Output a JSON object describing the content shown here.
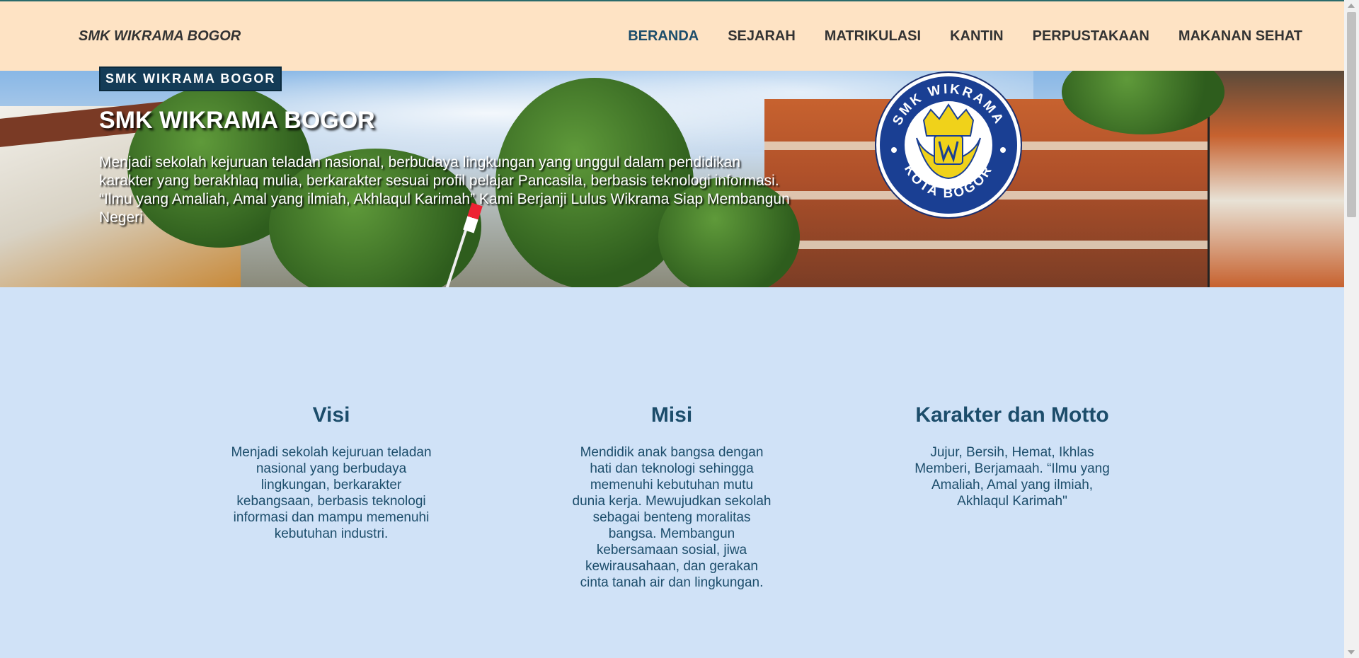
{
  "navbar": {
    "brand": "SMK WIKRAMA BOGOR",
    "links": [
      "BERANDA",
      "SEJARAH",
      "MATRIKULASI",
      "KANTIN",
      "PERPUSTAKAAN",
      "MAKANAN SEHAT"
    ],
    "active": "BERANDA"
  },
  "hero": {
    "badge": "SMK WIKRAMA BOGOR",
    "title": "SMK WIKRAMA BOGOR",
    "description": "Menjadi sekolah kejuruan teladan nasional, berbudaya lingkungan yang unggul dalam pendidikan karakter yang berakhlaq mulia, berkarakter sesuai profil pelajar Pancasila, berbasis teknologi informasi. “Ilmu yang Amaliah, Amal yang ilmiah, Akhlaqul Karimah” Kami Berjanji Lulus Wikrama Siap Membangun Negeri",
    "logo_top_text": "SMK WIKRAMA",
    "logo_bottom_text": "KOTA BOGOR"
  },
  "sections": [
    {
      "title": "Visi",
      "text": "Menjadi sekolah kejuruan teladan nasional yang berbudaya lingkungan, berkarakter kebangsaan, berbasis teknologi informasi dan mampu memenuhi kebutuhan industri."
    },
    {
      "title": "Misi",
      "text": "Mendidik anak bangsa dengan hati dan teknologi sehingga memenuhi kebutuhan mutu dunia kerja. Mewujudkan sekolah sebagai benteng moralitas bangsa. Membangun kebersamaan sosial, jiwa kewirausahaan, dan gerakan cinta tanah air dan lingkungan."
    },
    {
      "title": "Karakter dan Motto",
      "text": "Jujur, Bersih, Hemat, Ikhlas Memberi, Berjamaah. “Ilmu yang Amaliah, Amal yang ilmiah, Akhlaqul Karimah\""
    }
  ],
  "colors": {
    "navbar_bg": "#fee3c4",
    "page_bg": "#d0e2f7",
    "heading": "#1c4d6b",
    "badge_bg": "#143c57"
  }
}
